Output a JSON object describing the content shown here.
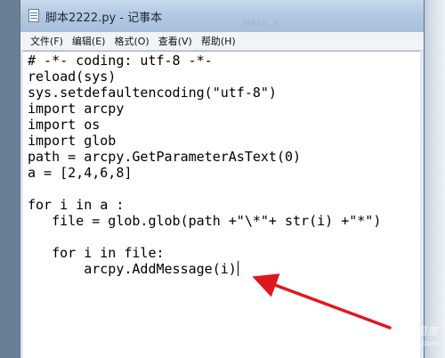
{
  "window": {
    "title": "脚本2222.py - 记事本",
    "ghost_text": "Mesh_3"
  },
  "menubar": {
    "items": [
      "文件(F)",
      "编辑(E)",
      "格式(O)",
      "查看(V)",
      "帮助(H)"
    ]
  },
  "editor": {
    "lines": [
      "# -*- coding: utf-8 -*-",
      "reload(sys)",
      "sys.setdefaultencoding(\"utf-8\")",
      "import arcpy",
      "import os",
      "import glob",
      "path = arcpy.GetParameterAsText(0)",
      "a = [2,4,6,8]",
      "",
      "for i in a :",
      "   file = glob.glob(path +\"\\*\"+ str(i) +\"*\")",
      "",
      "   for i in file:",
      "       arcpy.AddMessage(i)"
    ]
  },
  "annotation": {
    "arrow_color": "#e0161d"
  },
  "watermark": {
    "text": "Bai 百度",
    "sub": "jingyan.baidu.com"
  }
}
